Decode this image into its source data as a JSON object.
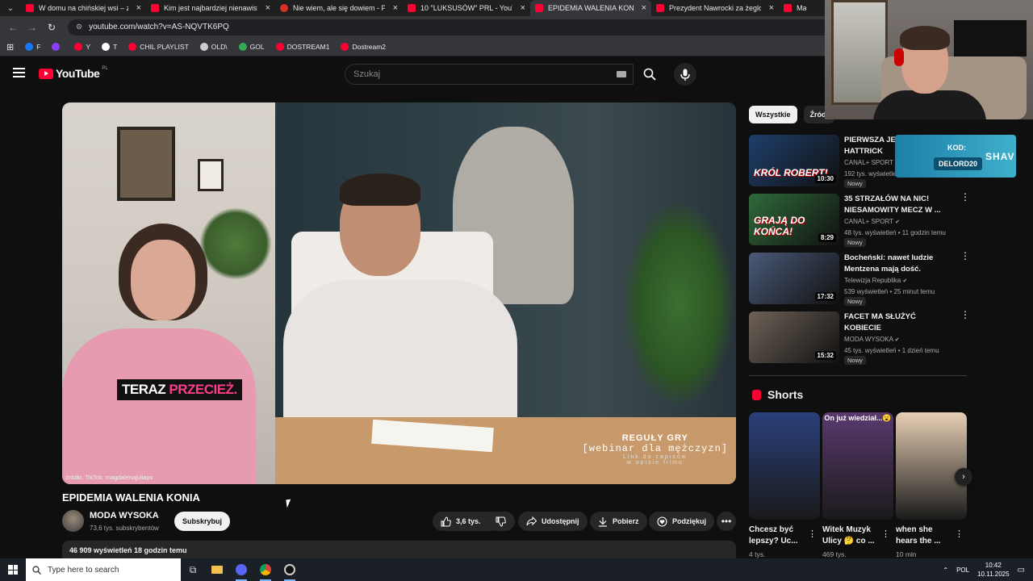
{
  "browser": {
    "tabs": [
      {
        "title": "W domu na chińskiej wsi – zob",
        "active": false
      },
      {
        "title": "Kim jest najbardziej nienawistn",
        "active": false
      },
      {
        "title": "Nie wiem, ale się dowiem - Pat",
        "active": false
      },
      {
        "title": "10 \"LUKSUSÓW\" PRL - YouTub",
        "active": false
      },
      {
        "title": "EPIDEMIA WALENIA KONI",
        "active": true
      },
      {
        "title": "Prezydent Nawrocki za żeglow",
        "active": false
      },
      {
        "title": "Matk",
        "active": false
      }
    ],
    "url": "youtube.com/watch?v=AS-NQVTK6PQ",
    "bookmarks": [
      {
        "label": "F",
        "color": "#1877f2"
      },
      {
        "label": "",
        "color": "#8a3ffc"
      },
      {
        "label": "Y",
        "color": "#ff0033"
      },
      {
        "label": "T",
        "color": "#ffffff"
      },
      {
        "label": "CHIL PLAYLIST",
        "color": "#ff0033"
      },
      {
        "label": "OLD\\",
        "color": "#cccccc"
      },
      {
        "label": "GOL",
        "color": "#34a853"
      },
      {
        "label": "DOSTREAM1",
        "color": "#ff0033"
      },
      {
        "label": "Dostream2",
        "color": "#ff0033"
      }
    ]
  },
  "youtube": {
    "logo": "YouTube",
    "country": "PL",
    "search_placeholder": "Szukaj"
  },
  "video": {
    "caption_white": "TERAZ ",
    "caption_pink": "PRZECIEŻ.",
    "source": "źródło: TikTok: magdalenajuliaps",
    "promo_line1": "REGUŁY GRY",
    "promo_line2": "[webinar dla mężczyzn]",
    "promo_line3": "Link do zapisów",
    "promo_line4": "w opisie filmu",
    "title": "EPIDEMIA WALENIA KONIA",
    "channel": "MODA WYSOKA",
    "subscribers": "73,6 tys. subskrybentów",
    "subscribe": "Subskrybuj",
    "likes": "3,6 tys.",
    "share": "Udostępnij",
    "download": "Pobierz",
    "thanks": "Podziękuj",
    "views_time": "46 909 wyświetleń  18 godzin temu"
  },
  "sidebar": {
    "chips": [
      "Wszystkie",
      "Źródł"
    ],
    "recommendations": [
      {
        "title": "PIERWSZA JEDNYM RAZU HATTRICK",
        "channel": "CANAL+ SPORT",
        "meta": "192 tys. wyświetleń",
        "badge": "Nowy",
        "duration": "10:30",
        "thumb_text": "KRÓL ROBERT!",
        "thumb_color": "#1e3f6b"
      },
      {
        "title": "35 STRZAŁÓW NA NIC! NIESAMOWITY MECZ W ...",
        "channel": "CANAL+ SPORT",
        "meta": "48 tys. wyświetleń • 11 godzin temu",
        "badge": "Nowy",
        "duration": "8:29",
        "thumb_text": "GRAJĄ DO KOŃCA!",
        "thumb_color": "#2f6a3a"
      },
      {
        "title": "Bocheński: nawet ludzie Mentzena mają dość. „Sławo...",
        "channel": "Telewizja Republika",
        "meta": "539 wyświetleń • 25 minut temu",
        "badge": "Nowy",
        "duration": "17:32",
        "thumb_text": "",
        "thumb_color": "#4a5a78"
      },
      {
        "title": "FACET MA SŁUŻYĆ KOBIECIE",
        "channel": "MODA WYSOKA",
        "meta": "45 tys. wyświetleń • 1 dzień temu",
        "badge": "Nowy",
        "duration": "15:32",
        "thumb_text": "",
        "thumb_color": "#6e6258"
      }
    ],
    "shorts_heading": "Shorts",
    "shorts": [
      {
        "title": "Chcesz być lepszy? Uc...",
        "views": "4 tys.",
        "overlay": "",
        "color": "#2a3f7a"
      },
      {
        "title": "Witek Muzyk Ulicy 🤔 co ...",
        "views": "469 tys.",
        "overlay": "On już wiedział...😮",
        "color": "#5a3a6e"
      },
      {
        "title": "when she hears the ...",
        "views": "10 mln",
        "overlay": "",
        "color": "#e8cfb5"
      }
    ]
  },
  "webcam_promo": {
    "label": "KOD:",
    "code": "DELORD20",
    "brand": "SHAV"
  },
  "taskbar": {
    "search_placeholder": "Type here to search",
    "lang": "POL",
    "time": "10:42",
    "date": "10.11.2025"
  }
}
